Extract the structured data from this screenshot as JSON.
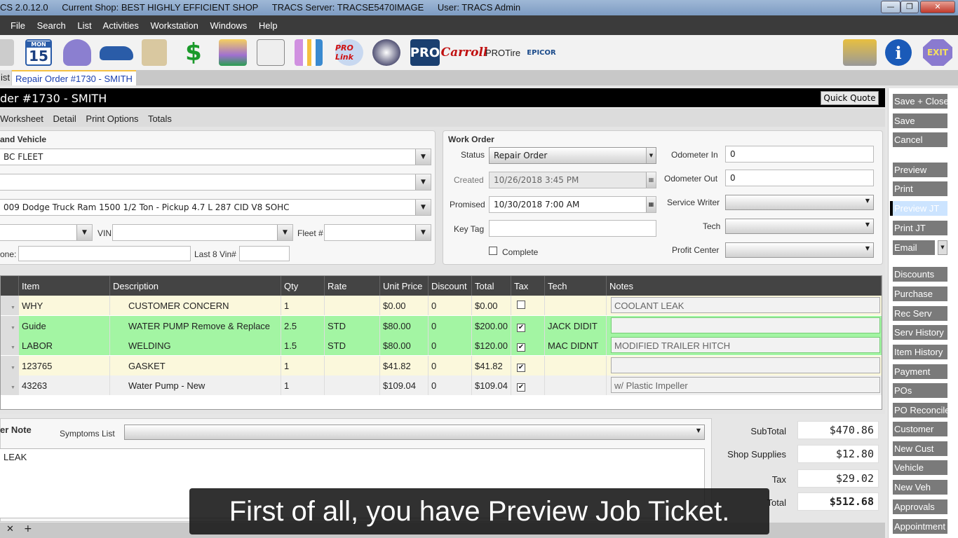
{
  "titlebar": {
    "app": "CS 2.0.12.0",
    "shop": "Current Shop: BEST HIGHLY EFFICIENT SHOP",
    "server": "TRACS Server: TRACSE5470IMAGE",
    "user": "User: TRACS Admin",
    "min": "—",
    "max": "❐",
    "close": "✕"
  },
  "menu": [
    "File",
    "Search",
    "List",
    "Activities",
    "Workstation",
    "Windows",
    "Help"
  ],
  "toolbar": {
    "calendar_day": "MON",
    "calendar_date": "15",
    "pro": "PRO",
    "carroll": "Carroll",
    "protire": "PROTire",
    "epicor": "EPICOR",
    "prolink": "PRO Link",
    "info": "i",
    "exit": "EXIT"
  },
  "tabs": [
    {
      "label": "ist"
    },
    {
      "label": "Repair Order #1730 - SMITH",
      "active": true
    }
  ],
  "header": {
    "title": "der #1730 - SMITH",
    "quick_quote": "Quick Quote"
  },
  "subtabs": [
    "Worksheet",
    "Detail",
    "Print Options",
    "Totals"
  ],
  "customer": {
    "title": "and Vehicle",
    "customer": "BC FLEET",
    "contact": "",
    "vehicle": "009 Dodge Truck Ram 1500 1/2 Ton - Pickup 4.7 L 287 CID V8 SOHC",
    "vin_label": "VIN",
    "vin": "",
    "fleet_label": "Fleet #",
    "fleet": "",
    "phone_label": "one:",
    "phone": "",
    "last8_label": "Last 8 Vin#",
    "last8": ""
  },
  "work_order": {
    "title": "Work Order",
    "status_label": "Status",
    "status": "Repair Order",
    "created_label": "Created",
    "created": "10/26/2018 3:45 PM",
    "promised_label": "Promised",
    "promised": "10/30/2018 7:00 AM",
    "keytag_label": "Key Tag",
    "keytag": "",
    "complete_label": "Complete",
    "odo_in_label": "Odometer In",
    "odo_in": "0",
    "odo_out_label": "Odometer Out",
    "odo_out": "0",
    "writer_label": "Service Writer",
    "tech_label": "Tech",
    "profit_label": "Profit Center"
  },
  "grid": {
    "columns": [
      "Item",
      "Description",
      "Qty",
      "Rate",
      "Unit Price",
      "Discount",
      "Total",
      "Tax",
      "Tech",
      "Notes"
    ],
    "rows": [
      {
        "item": "WHY",
        "desc": "CUSTOMER CONCERN",
        "qty": "1",
        "rate": "",
        "unit": "$0.00",
        "disc": "0",
        "total": "$0.00",
        "tax": false,
        "tech": "",
        "notes": "COOLANT LEAK",
        "color": "#fbf8dc"
      },
      {
        "item": "Guide",
        "desc": "WATER PUMP Remove & Replace",
        "qty": "2.5",
        "rate": "STD",
        "unit": "$80.00",
        "disc": "0",
        "total": "$200.00",
        "tax": true,
        "tech": "JACK DIDIT",
        "notes": "",
        "color": "#a3f5a3"
      },
      {
        "item": "LABOR",
        "desc": "WELDING",
        "qty": "1.5",
        "rate": "STD",
        "unit": "$80.00",
        "disc": "0",
        "total": "$120.00",
        "tax": true,
        "tech": "MAC DIDNT",
        "notes": "MODIFIED TRAILER HITCH",
        "color": "#a3f5a3"
      },
      {
        "item": "123765",
        "desc": "GASKET",
        "qty": "1",
        "rate": "",
        "unit": "$41.82",
        "disc": "0",
        "total": "$41.82",
        "tax": true,
        "tech": "",
        "notes": "",
        "color": "#fbf8dc"
      },
      {
        "item": "43263",
        "desc": "Water Pump - New",
        "qty": "1",
        "rate": "",
        "unit": "$109.04",
        "disc": "0",
        "total": "$109.04",
        "tax": true,
        "tech": "",
        "notes": "w/ Plastic Impeller",
        "color": "#f0f0f0"
      }
    ]
  },
  "notes": {
    "title": "er Note",
    "symptoms_label": "Symptoms List",
    "text": "LEAK"
  },
  "totals": {
    "subtotal_label": "SubTotal",
    "subtotal": "$470.86",
    "supplies_label": "Shop Supplies",
    "supplies": "$12.80",
    "tax_label": "Tax",
    "tax": "$29.02",
    "total_label": "Total",
    "total": "$512.68"
  },
  "side_buttons": [
    "Save + Close",
    "Save",
    "Cancel",
    "Preview",
    "Print",
    "Preview JT",
    "Print JT",
    "Email",
    "Discounts",
    "Purchase",
    "Rec Serv",
    "Serv History",
    "Item History",
    "Payment",
    "POs",
    "PO Reconcile",
    "Customer",
    "New Cust",
    "Vehicle",
    "New Veh",
    "Approvals",
    "Appointment"
  ],
  "bottom_tabs": {
    "close": "✕",
    "add": "+"
  },
  "caption": "First of all, you have Preview Job Ticket.",
  "colors": {
    "accent": "#1a3fb0",
    "hover": "#cce4ff",
    "button": "#7a7a7a"
  }
}
